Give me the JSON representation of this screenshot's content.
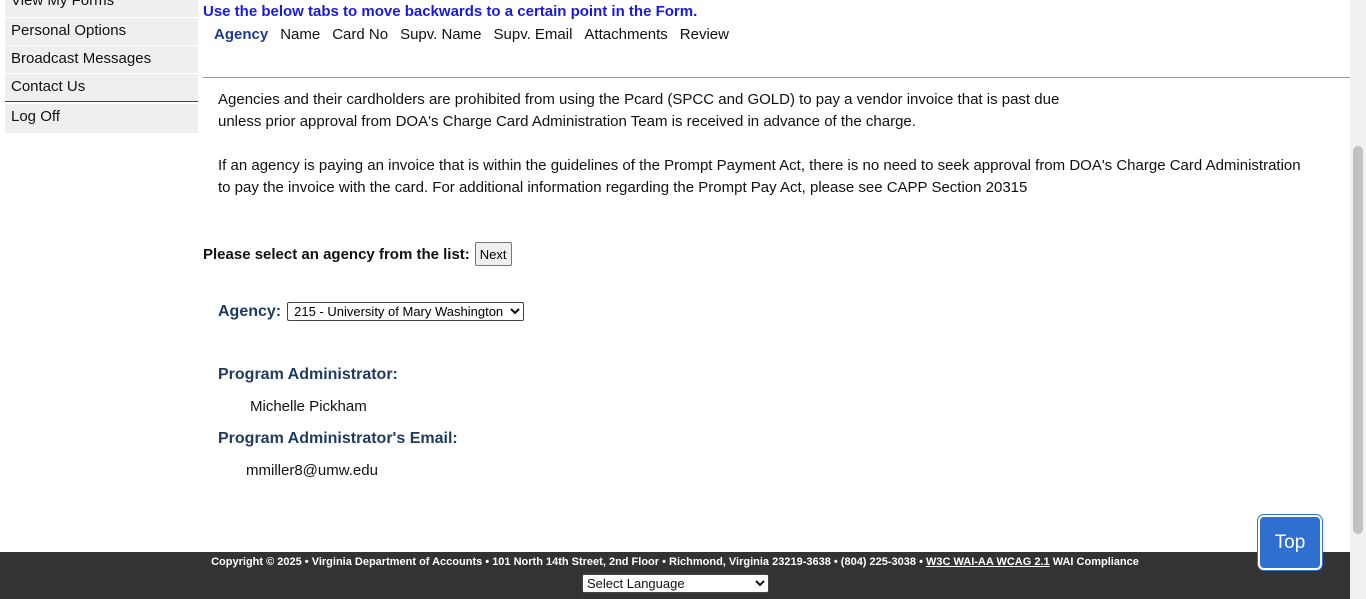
{
  "sidebar": {
    "items": [
      {
        "label": "View My Forms"
      },
      {
        "label": "Personal Options"
      },
      {
        "label": "Broadcast Messages"
      },
      {
        "label": "Contact Us"
      },
      {
        "label": "Log Off"
      }
    ]
  },
  "form": {
    "instruction": "Use the below tabs to move backwards to a certain point in the Form.",
    "tabs": [
      {
        "label": "Agency",
        "active": true
      },
      {
        "label": "Name"
      },
      {
        "label": "Card No"
      },
      {
        "label": "Supv. Name"
      },
      {
        "label": "Supv. Email"
      },
      {
        "label": "Attachments"
      },
      {
        "label": "Review"
      }
    ],
    "notice": {
      "line1": "Agencies and their cardholders are prohibited from using the Pcard (SPCC and GOLD) to pay a vendor invoice that is past due",
      "line2": "unless prior approval from DOA's Charge Card Administration Team is received in advance of the charge.",
      "line3": "If an agency is paying an invoice that is within the guidelines of the Prompt Payment Act, there is no need to seek approval from DOA's Charge Card Administration",
      "line4": "to pay the invoice with the card. For additional information regarding the Prompt Pay Act, please see CAPP Section 20315"
    },
    "select_prompt": "Please select an agency from the list:",
    "next_label": "Next",
    "agency_label": "Agency:",
    "agency_selected": "215 - University of Mary Washington",
    "program_admin_label": "Program Administrator:",
    "program_admin_value": "Michelle Pickham",
    "program_admin_email_label": "Program Administrator's Email:",
    "program_admin_email_value": "mmiller8@umw.edu"
  },
  "footer": {
    "copyright": "Copyright © 2025 • Virginia Department of Accounts • 101 North 14th Street, 2nd Floor • Richmond, Virginia 23219-3638 • (804) 225-3038 •",
    "wcag_link": "W3C WAI-AA WCAG 2.1",
    "wai_text": "WAI Compliance",
    "language_select": "Select Language"
  },
  "top_button": "Top",
  "colors": {
    "instruction": "#1a1adb",
    "label_blue": "#1e3a5f",
    "footer_bg": "#333333",
    "top_button_bg": "#2f6fd0"
  }
}
